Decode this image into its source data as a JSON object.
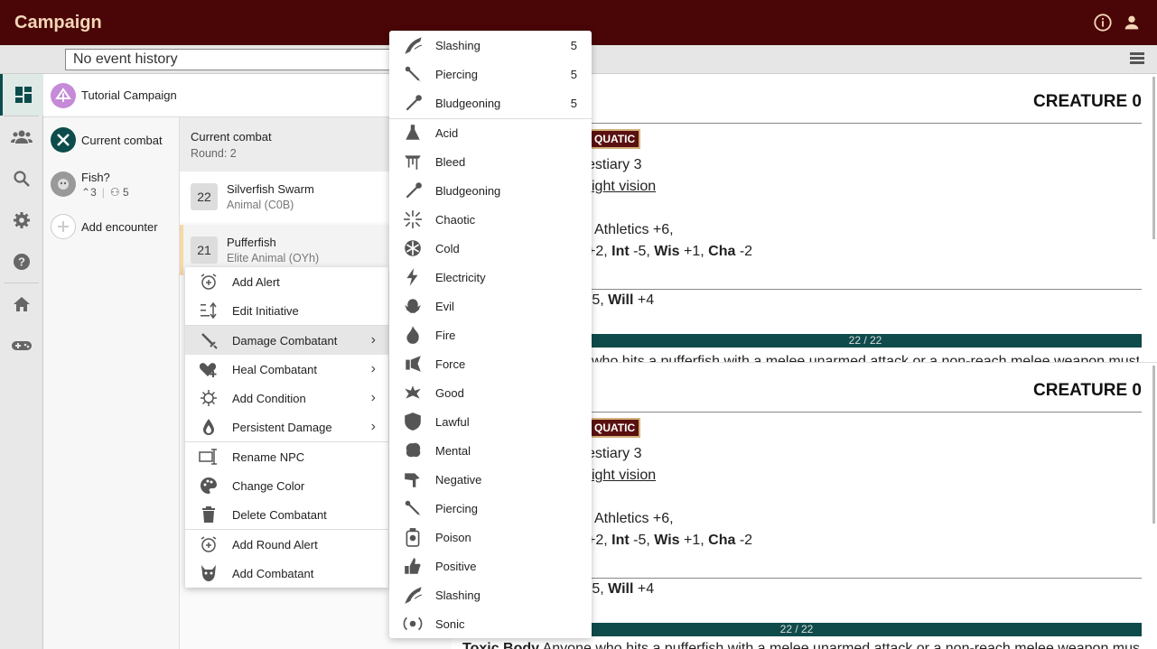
{
  "app": {
    "title": "Campaign"
  },
  "event_bar": {
    "value": "No event history"
  },
  "campaign": {
    "name": "Tutorial Campaign",
    "encounters": [
      {
        "label": "Current combat"
      },
      {
        "label": "Fish?",
        "level": "3",
        "party": "5"
      },
      {
        "label": "Add encounter"
      }
    ]
  },
  "combat": {
    "title": "Current combat",
    "round": "Round: 2",
    "combatants": [
      {
        "initiative": "22",
        "name": "Silverfish Swarm",
        "sub": "Animal (C0B)"
      },
      {
        "initiative": "21",
        "name": "Pufferfish",
        "sub": "Elite Animal (OYh)"
      }
    ]
  },
  "context_menu": {
    "items": [
      {
        "label": "Add Alert",
        "icon": "alarm-add-icon"
      },
      {
        "label": "Edit Initiative",
        "icon": "sort-icon"
      },
      {
        "label": "Damage Combatant",
        "icon": "sword-icon",
        "submenu": true
      },
      {
        "label": "Heal Combatant",
        "icon": "heart-plus-icon",
        "submenu": true
      },
      {
        "label": "Add Condition",
        "icon": "virus-icon",
        "submenu": true
      },
      {
        "label": "Persistent Damage",
        "icon": "drops-icon",
        "submenu": true
      },
      {
        "label": "Rename NPC",
        "icon": "rename-icon"
      },
      {
        "label": "Change Color",
        "icon": "palette-icon"
      },
      {
        "label": "Delete Combatant",
        "icon": "trash-icon"
      },
      {
        "label": "Add Round Alert",
        "icon": "alarm-add-icon"
      },
      {
        "label": "Add Combatant",
        "icon": "monster-icon"
      }
    ]
  },
  "damage_menu": {
    "items": [
      {
        "label": "Slashing",
        "count": "5"
      },
      {
        "label": "Piercing",
        "count": "5"
      },
      {
        "label": "Bludgeoning",
        "count": "5"
      },
      {
        "label": "Acid"
      },
      {
        "label": "Bleed"
      },
      {
        "label": "Bludgeoning"
      },
      {
        "label": "Chaotic"
      },
      {
        "label": "Cold"
      },
      {
        "label": "Electricity"
      },
      {
        "label": "Evil"
      },
      {
        "label": "Fire"
      },
      {
        "label": "Force"
      },
      {
        "label": "Good"
      },
      {
        "label": "Lawful"
      },
      {
        "label": "Mental"
      },
      {
        "label": "Negative"
      },
      {
        "label": "Piercing"
      },
      {
        "label": "Poison"
      },
      {
        "label": "Positive"
      },
      {
        "label": "Slashing"
      },
      {
        "label": "Sonic"
      }
    ]
  },
  "stat_blocks": [
    {
      "creature": "CREATURE 0",
      "trait": "QUATIC",
      "source": "estiary 3",
      "senses": "ight vision",
      "skills": ", Athletics +6,",
      "attr_pre": "+2, ",
      "int_label": "Int",
      "int_val": " -5, ",
      "wis_label": "Wis",
      "wis_val": " +1, ",
      "cha_label": "Cha",
      "cha_val": " -2",
      "saves_pre": "-5, ",
      "will_label": "Will",
      "will_val": " +4",
      "hp": "22 / 22",
      "ability": "who hits a pufferfish with a melee unarmed attack or a non-reach melee weapon must"
    },
    {
      "creature": "CREATURE 0",
      "trait": "QUATIC",
      "source": "estiary 3",
      "senses": "ight vision",
      "skills": ", Athletics +6,",
      "attr_pre": "+2, ",
      "int_label": "Int",
      "int_val": " -5, ",
      "wis_label": "Wis",
      "wis_val": " +1, ",
      "cha_label": "Cha",
      "cha_val": " -2",
      "saves_pre": "-5, ",
      "will_label": "Will",
      "will_val": " +4",
      "hp": "22 / 22",
      "ability_bold": "Toxic Body",
      "ability": " Anyone who hits a pufferfish with a melee unarmed attack or a non-reach melee weapon must"
    }
  ]
}
